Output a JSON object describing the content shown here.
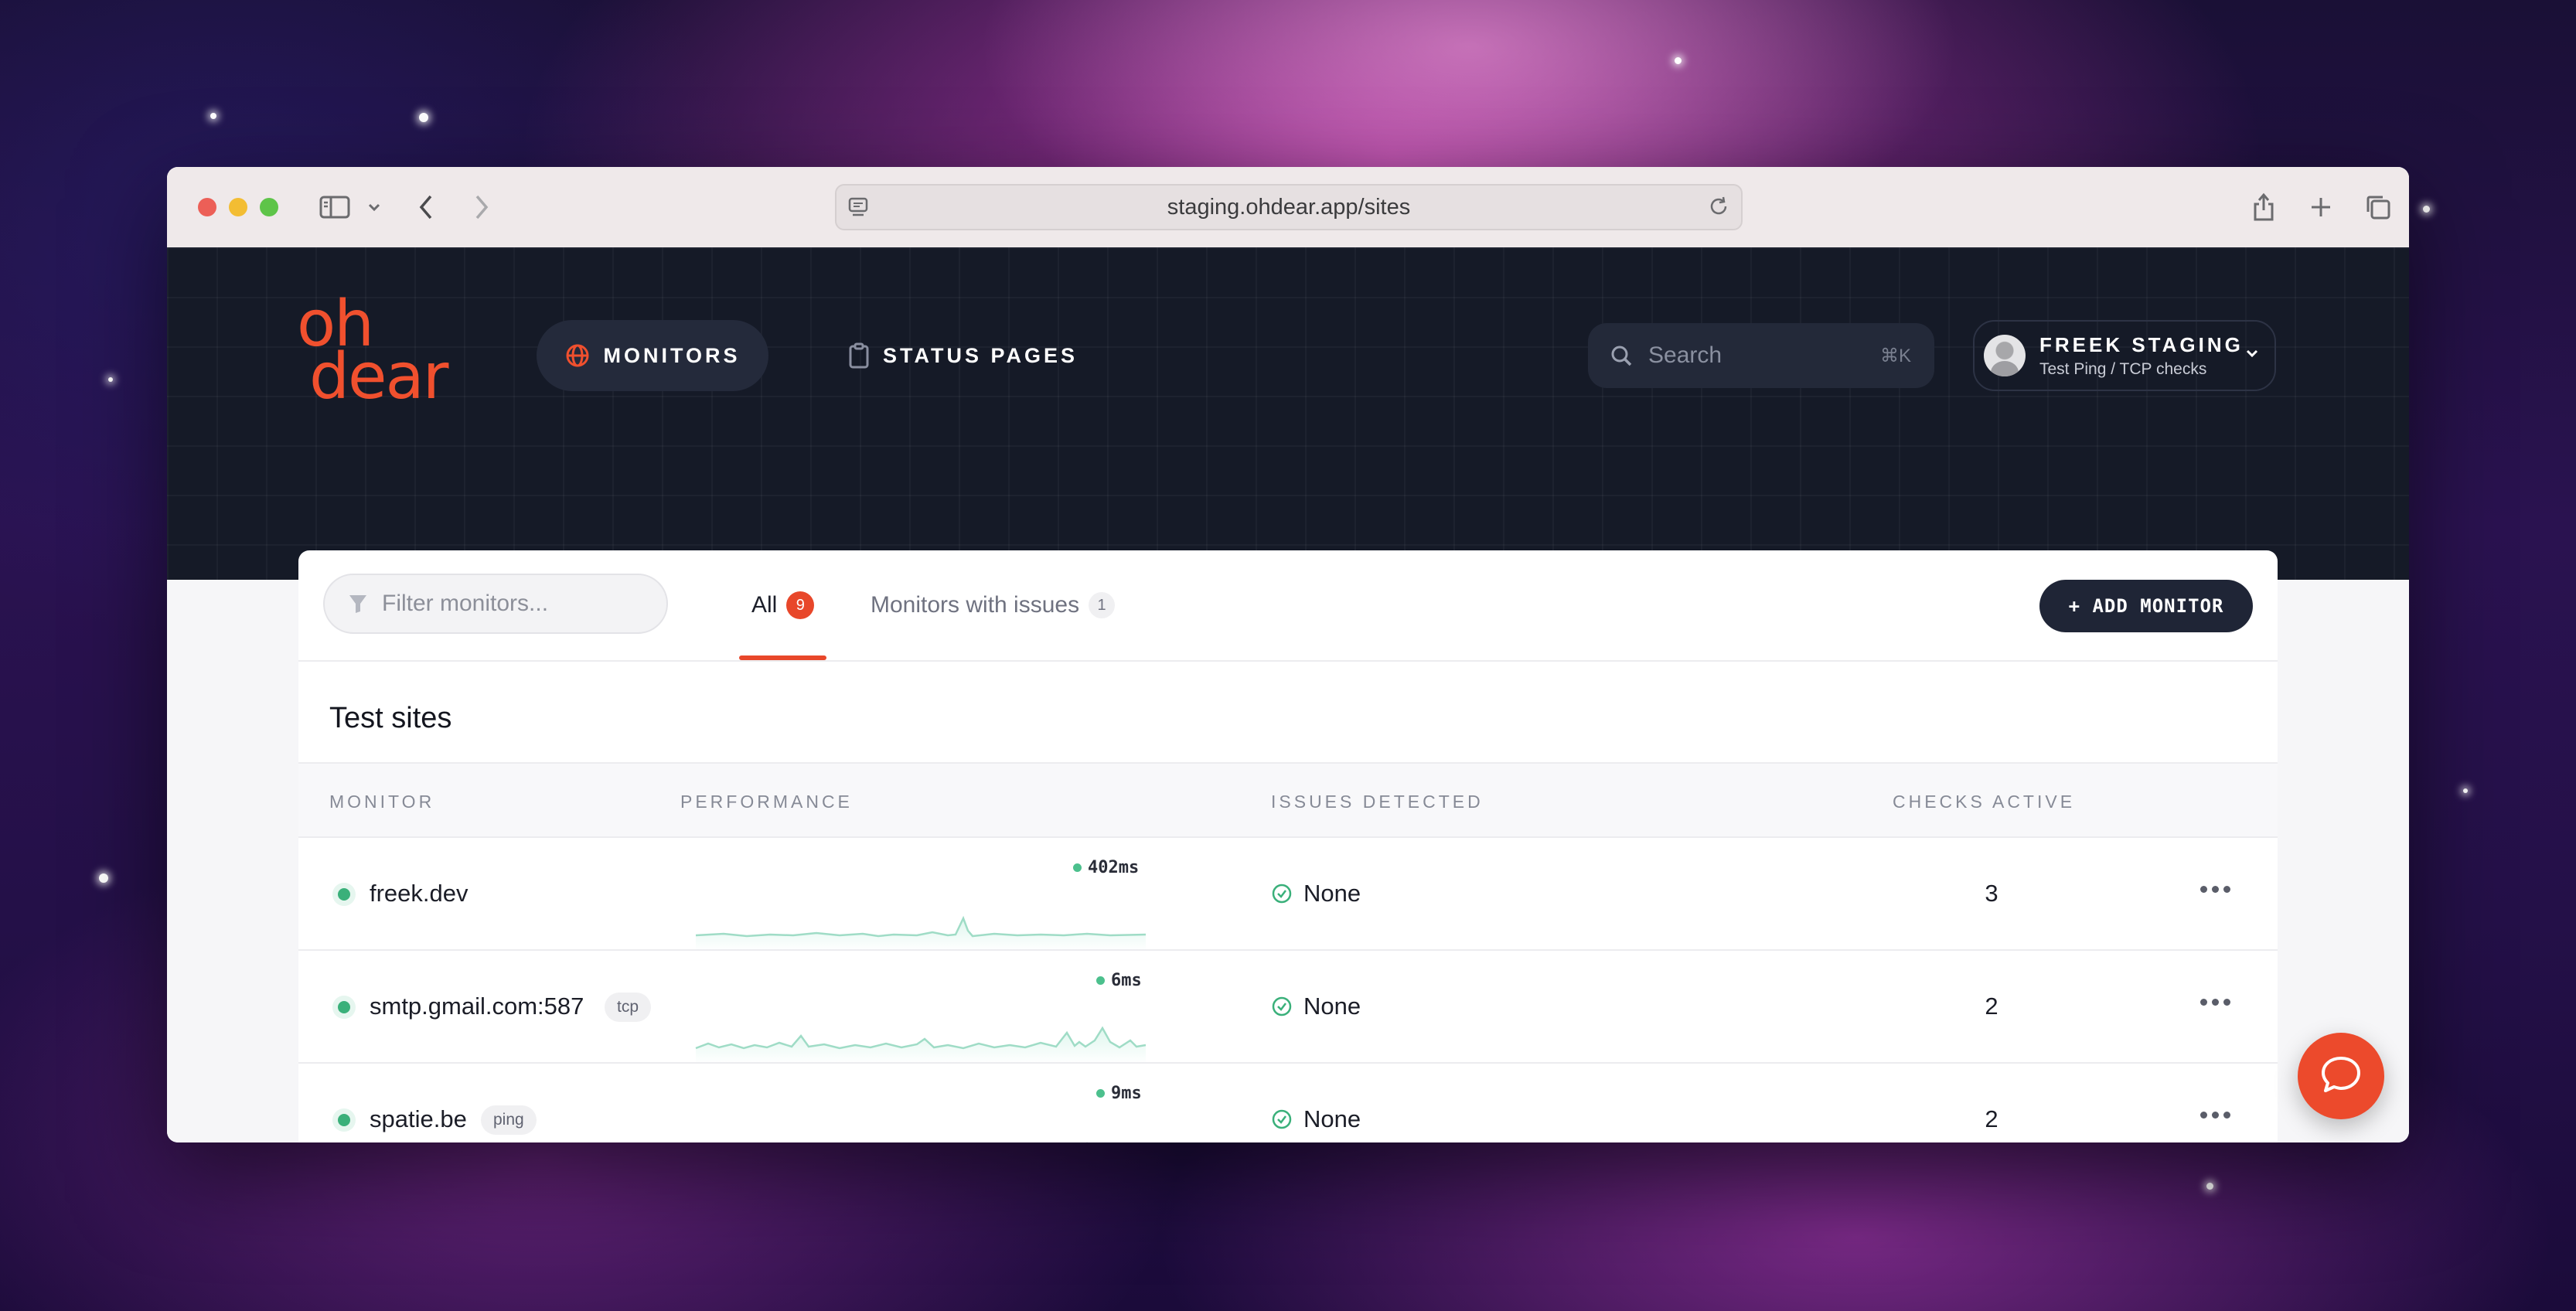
{
  "browser": {
    "url": "staging.ohdear.app/sites"
  },
  "header": {
    "logo_line1": "oh",
    "logo_line2": "dear",
    "nav": [
      {
        "label": "MONITORS",
        "icon": "globe-icon",
        "active": true
      },
      {
        "label": "STATUS PAGES",
        "icon": "clipboard-icon",
        "active": false
      }
    ],
    "search": {
      "placeholder": "Search",
      "shortcut": "⌘K"
    },
    "account": {
      "name": "FREEK STAGING",
      "subtitle": "Test Ping / TCP checks"
    }
  },
  "toolbar": {
    "filter_placeholder": "Filter monitors...",
    "tabs": [
      {
        "label": "All",
        "count": "9"
      },
      {
        "label": "Monitors with issues",
        "count": "1"
      }
    ],
    "add_button": "+ ADD MONITOR"
  },
  "group": {
    "title": "Test sites",
    "columns": [
      "MONITOR",
      "PERFORMANCE",
      "ISSUES DETECTED",
      "CHECKS ACTIVE"
    ],
    "rows": [
      {
        "name": "freek.dev",
        "tag": "",
        "latency": "402ms",
        "issues": "None",
        "checks": "3",
        "status": "up"
      },
      {
        "name": "smtp.gmail.com:587",
        "tag": "tcp",
        "latency": "6ms",
        "issues": "None",
        "checks": "2",
        "status": "up"
      },
      {
        "name": "spatie.be",
        "tag": "ping",
        "latency": "9ms",
        "issues": "None",
        "checks": "2",
        "status": "up"
      }
    ]
  },
  "colors": {
    "accent": "#e8472a",
    "header_bg": "#151a27",
    "status_up": "#3ab07a",
    "sparkline": "#9fdcc6"
  }
}
